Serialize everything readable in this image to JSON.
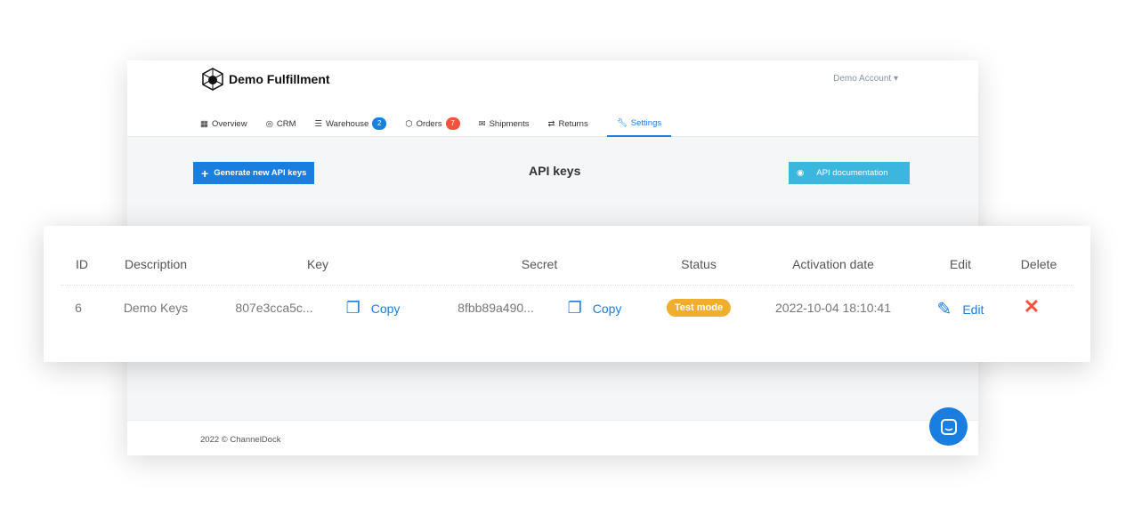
{
  "header": {
    "brand": "Demo Fulfillment",
    "account": "Demo Account"
  },
  "nav": [
    {
      "label": "Overview",
      "icon": "grid-icon"
    },
    {
      "label": "CRM",
      "icon": "user-circle-icon"
    },
    {
      "label": "Warehouse",
      "icon": "list-icon",
      "badge": "2",
      "badge_color": "#1a7de0"
    },
    {
      "label": "Orders",
      "icon": "box-icon",
      "badge": "7",
      "badge_color": "#f0533e"
    },
    {
      "label": "Shipments",
      "icon": "envelope-icon"
    },
    {
      "label": "Returns",
      "icon": "arrows-icon"
    },
    {
      "label": "Settings",
      "icon": "wrench-icon",
      "active": true
    }
  ],
  "toolbar": {
    "generate_label": "Generate new API keys",
    "title": "API keys",
    "docs_label": "API documentation"
  },
  "table": {
    "headers": [
      "ID",
      "Description",
      "Key",
      "Secret",
      "Status",
      "Activation date",
      "Edit",
      "Delete"
    ],
    "rows": [
      {
        "id": "6",
        "description": "Demo Keys",
        "key": "807e3cca5c...",
        "copy_key": "Copy",
        "secret": "8fbb89a490...",
        "copy_secret": "Copy",
        "status": "Test mode",
        "date": "2022-10-04 18:10:41",
        "edit": "Edit"
      }
    ]
  },
  "footer": {
    "text": "2022 © ChannelDock"
  },
  "colors": {
    "primary": "#1a7de0",
    "info": "#3bb7dd",
    "warning": "#f0ad2e",
    "danger": "#f0533e"
  }
}
